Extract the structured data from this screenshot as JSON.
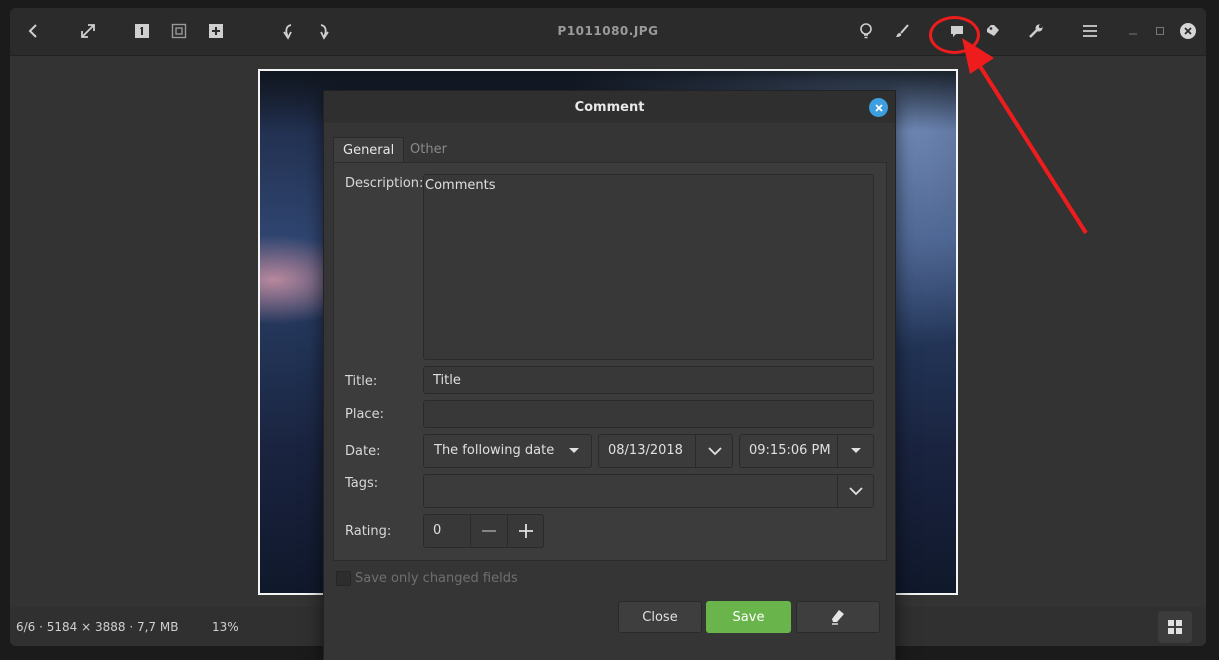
{
  "window": {
    "title": "P1011080.JPG"
  },
  "toolbar": {
    "left_icons": [
      "back-icon",
      "fullscreen-icon",
      "zoom-1to1-icon",
      "zoom-fit-icon",
      "zoom-in-icon",
      "rotate-left-icon",
      "rotate-right-icon"
    ],
    "right_icons": [
      "lightbulb-icon",
      "brush-icon",
      "comment-icon",
      "tag-icon",
      "wrench-icon",
      "menu-icon"
    ],
    "window_controls": [
      "minimize-icon",
      "maximize-icon",
      "close-icon"
    ]
  },
  "status": {
    "info": "6/6 · 5184 × 3888 · 7,7 MB",
    "zoom": "13%",
    "grid_icon": "grid-icon"
  },
  "annotation": {
    "color": "#ee1c1c"
  },
  "dialog": {
    "title": "Comment",
    "tabs": [
      {
        "label": "General"
      },
      {
        "label": "Other"
      }
    ],
    "description": {
      "label": "Description:",
      "value": "Comments"
    },
    "title_field": {
      "label": "Title:",
      "value": "Title"
    },
    "place": {
      "label": "Place:",
      "value": ""
    },
    "date": {
      "label": "Date:",
      "mode": "The following date",
      "date": "08/13/2018",
      "time": "09:15:06 PM"
    },
    "tags": {
      "label": "Tags:",
      "value": ""
    },
    "rating": {
      "label": "Rating:",
      "value": "0"
    },
    "save_only_changed": {
      "label": "Save only changed fields",
      "checked": false
    },
    "buttons": {
      "close": "Close",
      "save": "Save"
    },
    "accent": "#3d9ee0",
    "save_color": "#6ab54b"
  }
}
